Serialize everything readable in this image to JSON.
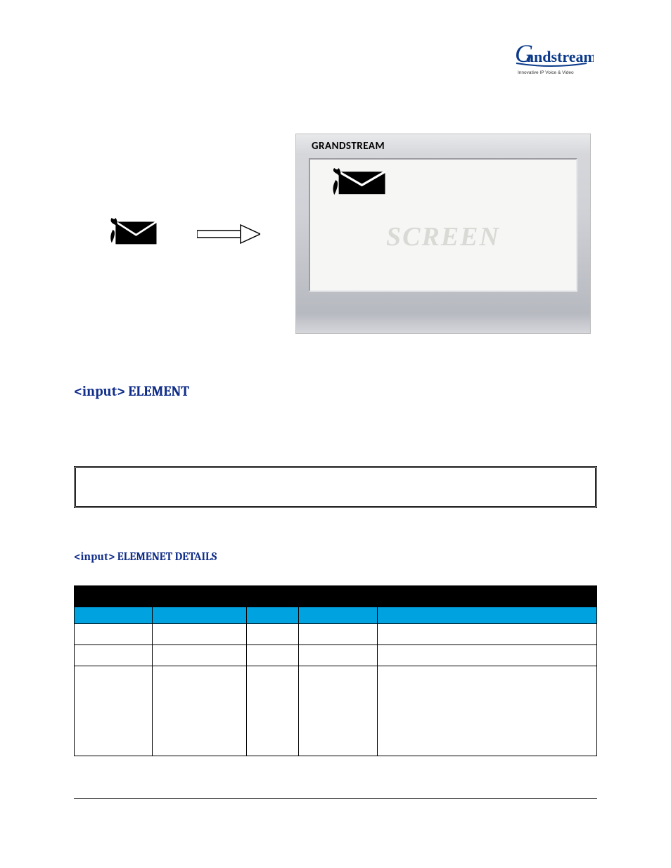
{
  "logo": {
    "brand": "Grandstream",
    "tagline": "Innovative IP Voice & Video"
  },
  "figure": {
    "device_label": "GRANDSTREAM",
    "screen_watermark": "SCREEN"
  },
  "section_heading": "<input> ELEMENT",
  "sub_heading": "<input> ELEMENET DETAILS",
  "table": {
    "top_headers": [
      "",
      ""
    ],
    "sub_headers": [
      "",
      "",
      "",
      "",
      ""
    ],
    "rows": [
      [
        "",
        "",
        "",
        "",
        ""
      ],
      [
        "",
        "",
        "",
        "",
        ""
      ],
      [
        "",
        "",
        "",
        "",
        ""
      ]
    ]
  }
}
